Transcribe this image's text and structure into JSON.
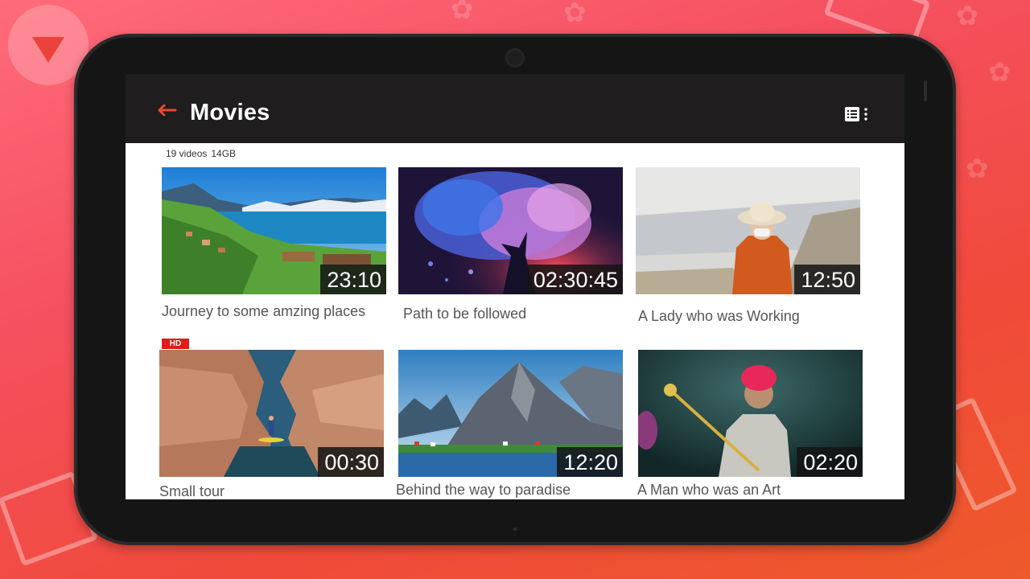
{
  "app": {
    "title": "Movies"
  },
  "folder": {
    "video_count": "19 videos",
    "size": "14GB"
  },
  "icons": {
    "back": "arrow-left-icon",
    "view": "list-view-icon",
    "menu": "more-vertical-icon"
  },
  "colors": {
    "accent": "#e8492f",
    "appbar": "#1f1d1d",
    "badge": "#e11b1b"
  },
  "videos": [
    {
      "title": "Journey to some amzing places",
      "duration": "23:10"
    },
    {
      "title": "Path to be followed",
      "duration": "02:30:45"
    },
    {
      "title": "A Lady who was Working",
      "duration": "12:50"
    },
    {
      "title": "Small tour",
      "duration": "00:30",
      "badge": "HD"
    },
    {
      "title": "Behind the way to paradise",
      "duration": "12:20"
    },
    {
      "title": "A Man who was an Art",
      "duration": "02:20"
    }
  ]
}
